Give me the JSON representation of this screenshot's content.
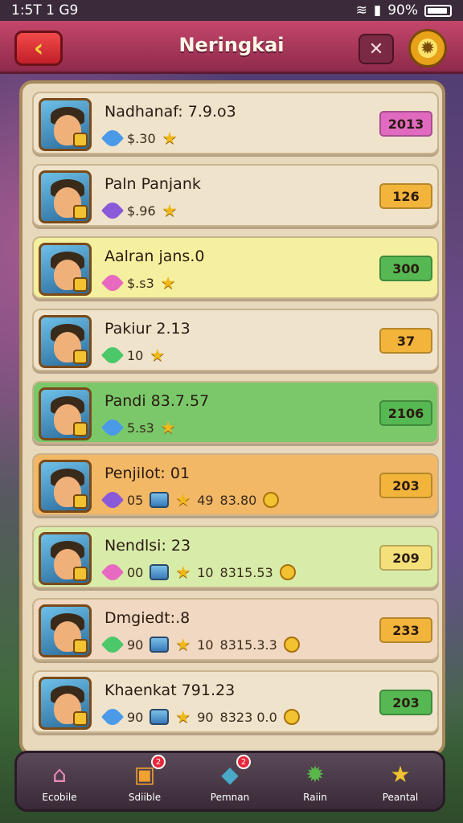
{
  "status_bar": {
    "time": "1:5T 1 G9",
    "battery": "90%"
  },
  "header": {
    "title": "Neringkai",
    "back_icon": "chevron-left-icon",
    "close_icon": "close-icon",
    "gear_icon": "gear-icon"
  },
  "rows": [
    {
      "name": "Nadhanaf: 7.9.o3",
      "stat1": "$.30",
      "stat2": "",
      "stat3": "",
      "value": "2013",
      "bg": "#efe3cc",
      "value_color": "#e06ac0"
    },
    {
      "name": "Paln Panjank",
      "stat1": "$.96",
      "stat2": "",
      "stat3": "",
      "value": "126",
      "bg": "#efe3cc",
      "value_color": "#f2b43a"
    },
    {
      "name": "Aalran jans.0",
      "stat1": "$.s3",
      "stat2": "",
      "stat3": "",
      "value": "300",
      "bg": "#f4f0a0",
      "value_color": "#56b852"
    },
    {
      "name": "Pakiur 2.13",
      "stat1": "10",
      "stat2": "",
      "stat3": "",
      "value": "37",
      "bg": "#efe3cc",
      "value_color": "#f2b43a"
    },
    {
      "name": "Pandi 83.7.57",
      "stat1": "5.s3",
      "stat2": "",
      "stat3": "",
      "value": "2106",
      "bg": "#7ac86a",
      "value_color": "#56b852"
    },
    {
      "name": "Penjilot: 01",
      "stat1": "05",
      "stat2": "49",
      "stat3": "83.80",
      "value": "203",
      "bg": "#f2b866",
      "value_color": "#f2b43a"
    },
    {
      "name": "Nendlsi: 23",
      "stat1": "00",
      "stat2": "10",
      "stat3": "8315.53",
      "value": "209",
      "bg": "#d8ecaa",
      "value_color": "#f4e07a"
    },
    {
      "name": "Dmgiedt:.8",
      "stat1": "90",
      "stat2": "10",
      "stat3": "8315.3.3",
      "value": "233",
      "bg": "#f0d8c2",
      "value_color": "#f2b43a"
    },
    {
      "name": "Khaenkat 791.23",
      "stat1": "90",
      "stat2": "90",
      "stat3": "8323 0.0",
      "value": "203",
      "bg": "#efe3cc",
      "value_color": "#56b852"
    }
  ],
  "nav": [
    {
      "label": "Ecobile",
      "icon": "home-icon",
      "badge": ""
    },
    {
      "label": "Sdiible",
      "icon": "chest-icon",
      "badge": "2"
    },
    {
      "label": "Pemnan",
      "icon": "gem-icon",
      "badge": "2"
    },
    {
      "label": "Raiin",
      "icon": "gear-icon",
      "badge": ""
    },
    {
      "label": "Peantal",
      "icon": "star-icon",
      "badge": ""
    }
  ]
}
